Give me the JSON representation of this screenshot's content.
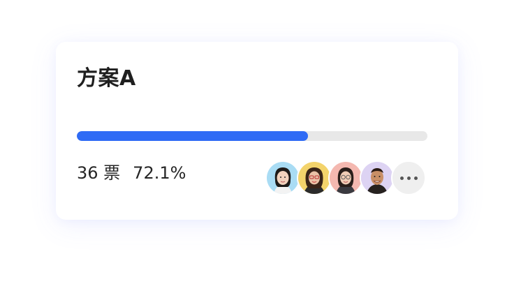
{
  "option": {
    "title": "方案A",
    "progress": 0.66,
    "votes_text": "36 票",
    "percent_text": "72.1%"
  },
  "voters": {
    "avatars": [
      {
        "name": "voter-avatar-1",
        "bg": "#a9dcf4"
      },
      {
        "name": "voter-avatar-2",
        "bg": "#f3d36b"
      },
      {
        "name": "voter-avatar-3",
        "bg": "#f4b8b0"
      },
      {
        "name": "voter-avatar-4",
        "bg": "#ddd3f3"
      }
    ],
    "more_icon": "more-dots-icon"
  },
  "colors": {
    "accent": "#2f6bf5",
    "track": "#e8e8e8"
  }
}
